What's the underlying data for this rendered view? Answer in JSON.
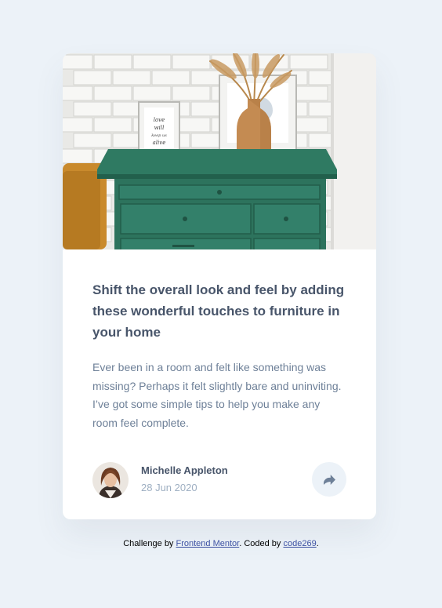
{
  "article": {
    "headline": "Shift the overall look and feel by adding these wonderful touches to furniture in your home",
    "excerpt": "Ever been in a room and felt like something was missing? Perhaps it felt slightly bare and uninviting. I’ve got some simple tips to help you make any room feel complete.",
    "frame_text": "love will keep us alive"
  },
  "author": {
    "name": "Michelle Appleton",
    "date": "28 Jun 2020"
  },
  "share": {
    "icon": "share-icon"
  },
  "attribution": {
    "prefix": "Challenge by ",
    "challenge_link": "Frontend Mentor",
    "middle": ". Coded by ",
    "coder_link": "code269",
    "suffix": "."
  },
  "colors": {
    "page_bg": "#ecf2f8",
    "card_bg": "#ffffff",
    "heading": "#48556a",
    "body_text": "#6e8098",
    "muted": "#9eafc2",
    "link": "#3e52a3"
  }
}
